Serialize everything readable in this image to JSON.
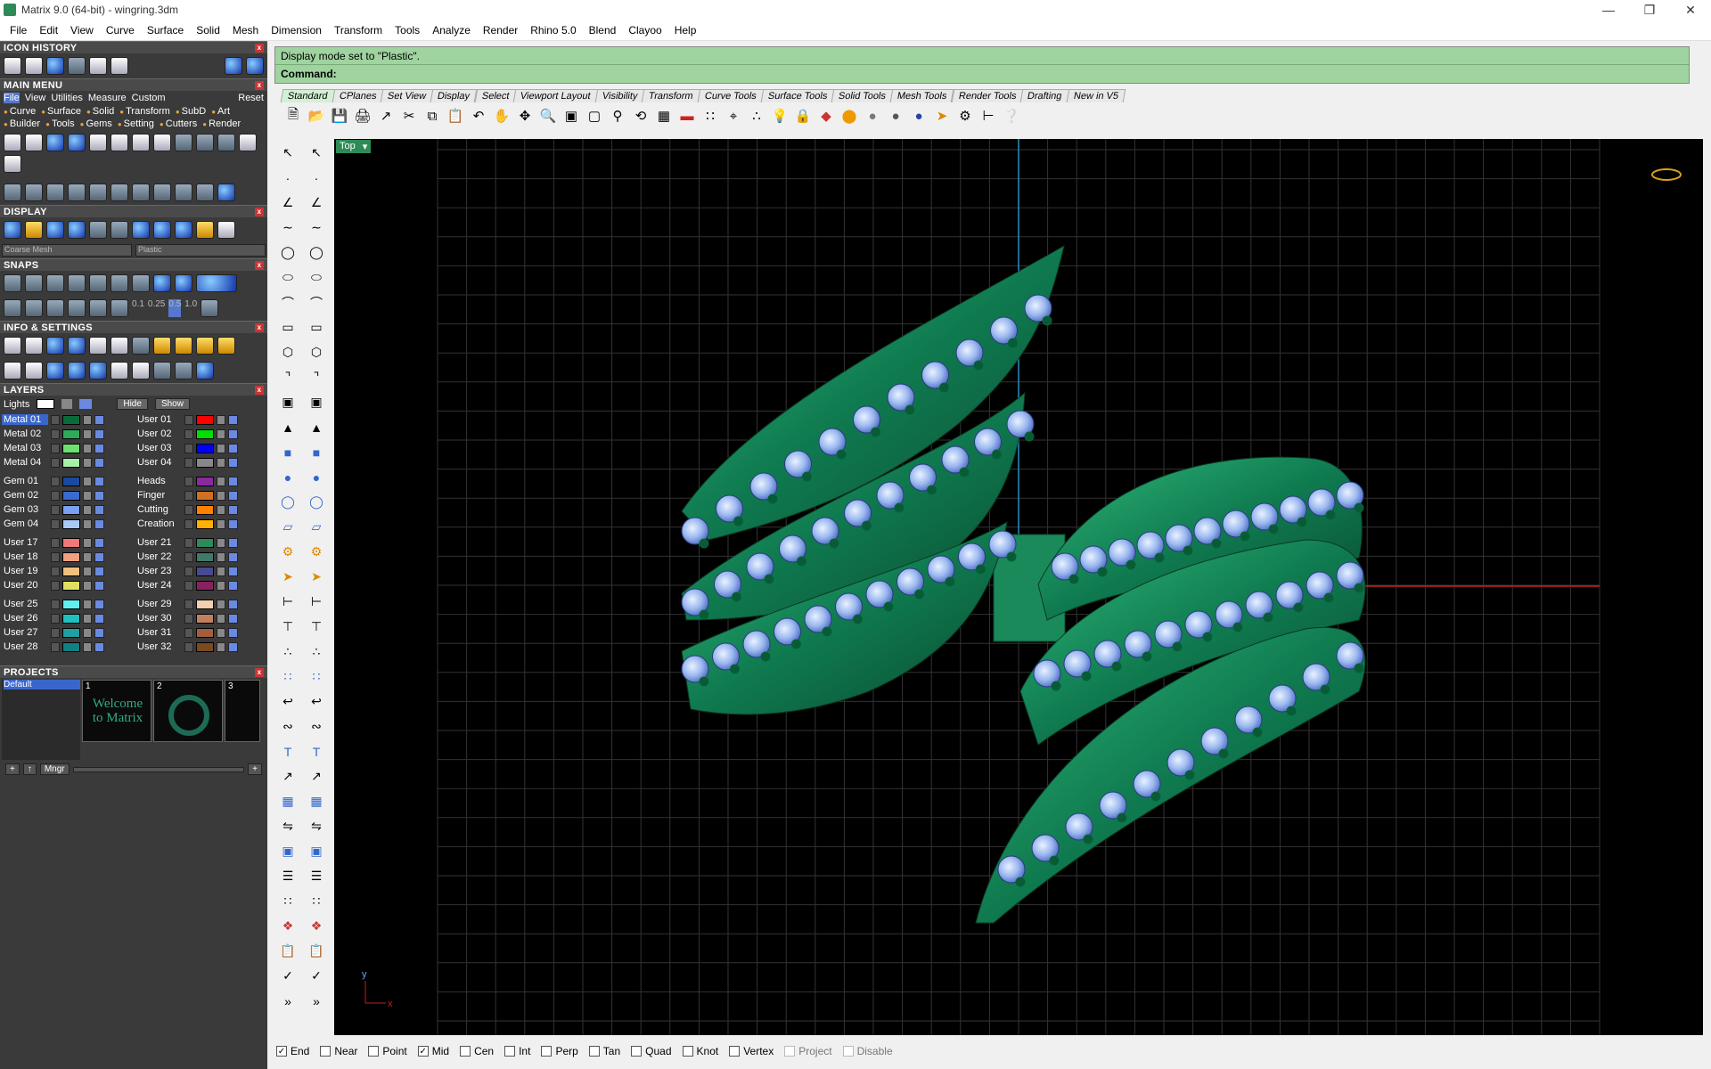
{
  "window": {
    "title": "Matrix 9.0 (64-bit) - wingring.3dm"
  },
  "menu": [
    "File",
    "Edit",
    "View",
    "Curve",
    "Surface",
    "Solid",
    "Mesh",
    "Dimension",
    "Transform",
    "Tools",
    "Analyze",
    "Render",
    "Rhino 5.0",
    "Blend",
    "Clayoo",
    "Help"
  ],
  "panels": {
    "icon_history": "ICON HISTORY",
    "main_menu": "MAIN MENU",
    "display": "DISPLAY",
    "snaps": "SNAPS",
    "info": "INFO & SETTINGS",
    "layers": "LAYERS",
    "projects": "PROJECTS"
  },
  "main_menu_tabs": [
    "File",
    "View",
    "Utilities",
    "Measure",
    "Custom",
    "Reset"
  ],
  "main_menu_sub": [
    "Curve",
    "Surface",
    "Solid",
    "Transform",
    "SubD",
    "Art",
    "Builder",
    "Tools",
    "Gems",
    "Setting",
    "Cutters",
    "Render"
  ],
  "display_dropdowns": {
    "mesh": "Coarse Mesh",
    "mode": "Plastic"
  },
  "snaps_values": [
    "0.1",
    "0.25",
    "0.5",
    "1.0"
  ],
  "layers_header": {
    "lights": "Lights",
    "hide": "Hide",
    "show": "Show"
  },
  "layers": {
    "left": [
      [
        "Metal 01",
        "Metal 02",
        "Metal 03",
        "Metal 04"
      ],
      [
        "Gem 01",
        "Gem 02",
        "Gem 03",
        "Gem 04"
      ],
      [
        "User 17",
        "User 18",
        "User 19",
        "User 20"
      ],
      [
        "User 25",
        "User 26",
        "User 27",
        "User 28"
      ]
    ],
    "right": [
      [
        "User 01",
        "User 02",
        "User 03",
        "User 04"
      ],
      [
        "Heads",
        "Finger",
        "Cutting",
        "Creation"
      ],
      [
        "User 21",
        "User 22",
        "User 23",
        "User 24"
      ],
      [
        "User 29",
        "User 30",
        "User 31",
        "User 32"
      ]
    ],
    "colors_left": [
      [
        "#0a6b3a",
        "#2faa5a",
        "#6fe06f",
        "#a8f0a8"
      ],
      [
        "#1a4aa0",
        "#3a6ad0",
        "#7aa0f0",
        "#a8c8f8"
      ],
      [
        "#f07878",
        "#f0a080",
        "#f0c080",
        "#e0e060"
      ],
      [
        "#60f0f0",
        "#20c0c0",
        "#20a0a0",
        "#108080"
      ]
    ],
    "colors_right": [
      [
        "#ff0000",
        "#00e000",
        "#0000ff",
        "#888888"
      ],
      [
        "#8a2aa0",
        "#d07020",
        "#ff8000",
        "#ffb000"
      ],
      [
        "#2e8a5a",
        "#407a6a",
        "#4a4a90",
        "#8a2060"
      ],
      [
        "#f0d0b0",
        "#c08060",
        "#a06040",
        "#7a4a20"
      ]
    ]
  },
  "projects": {
    "default": "Default",
    "thumbs": [
      "1",
      "2",
      "3"
    ],
    "welcome": "Welcome to Matrix",
    "mngr": "Mngr"
  },
  "command": {
    "line1": "Display mode set to \"Plastic\".",
    "line2": "Command:"
  },
  "toolbar_tabs": [
    "Standard",
    "CPlanes",
    "Set View",
    "Display",
    "Select",
    "Viewport Layout",
    "Visibility",
    "Transform",
    "Curve Tools",
    "Surface Tools",
    "Solid Tools",
    "Mesh Tools",
    "Render Tools",
    "Drafting",
    "New in V5"
  ],
  "viewport": {
    "name": "Top",
    "axis_y": "y",
    "axis_x": "x"
  },
  "osnaps": [
    {
      "label": "End",
      "checked": true
    },
    {
      "label": "Near",
      "checked": false
    },
    {
      "label": "Point",
      "checked": false
    },
    {
      "label": "Mid",
      "checked": true
    },
    {
      "label": "Cen",
      "checked": false
    },
    {
      "label": "Int",
      "checked": false
    },
    {
      "label": "Perp",
      "checked": false
    },
    {
      "label": "Tan",
      "checked": false
    },
    {
      "label": "Quad",
      "checked": false
    },
    {
      "label": "Knot",
      "checked": false
    },
    {
      "label": "Vertex",
      "checked": false
    },
    {
      "label": "Project",
      "checked": false
    },
    {
      "label": "Disable",
      "checked": false
    }
  ],
  "icons": {
    "close": "close-icon",
    "minimize": "minimize-icon",
    "maximize": "maximize-icon"
  }
}
